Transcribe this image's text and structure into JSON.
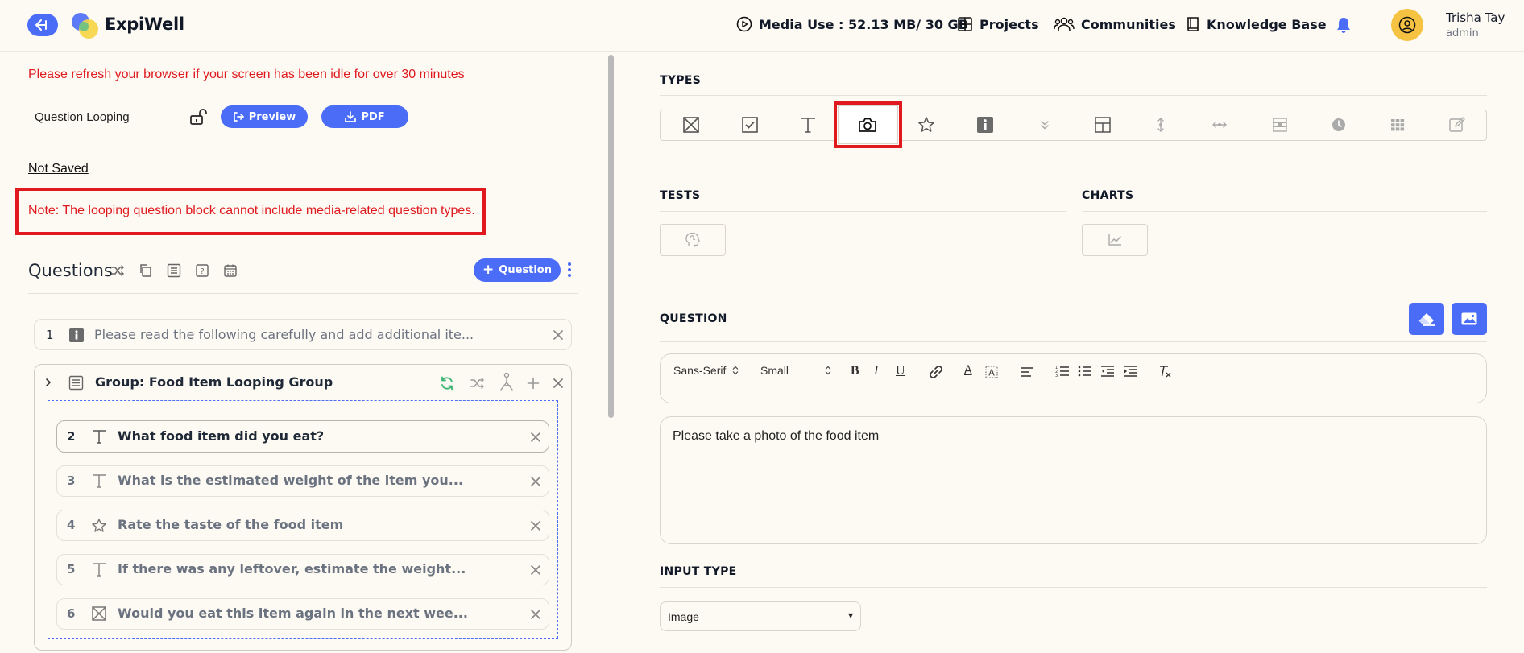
{
  "header": {
    "brand": "ExpiWell",
    "media_use": "Media Use : 52.13 MB/ 30 GB",
    "nav": {
      "projects": "Projects",
      "communities": "Communities",
      "knowledge_base": "Knowledge Base"
    },
    "user": {
      "name": "Trisha Tay",
      "role": "admin"
    }
  },
  "left": {
    "refresh_message": "Please refresh your browser if your screen has been idle for over 30 minutes",
    "looping_label": "Question Looping",
    "preview_label": "Preview",
    "pdf_label": "PDF",
    "not_saved": "Not Saved",
    "note": "Note: The looping question block cannot include media-related question types.",
    "questions_title": "Questions",
    "add_question_label": "Question",
    "first_question": {
      "number": "1",
      "text": "Please read the following carefully and add additional ite..."
    },
    "group": {
      "title": "Group: Food Item Looping Group",
      "items": [
        {
          "number": "2",
          "text": "What food item did you eat?"
        },
        {
          "number": "3",
          "text": "What is the estimated weight of the item you..."
        },
        {
          "number": "4",
          "text": "Rate the taste of the food item"
        },
        {
          "number": "5",
          "text": "If there was any leftover, estimate the weight..."
        },
        {
          "number": "6",
          "text": "Would you eat this item again in the next wee..."
        }
      ]
    }
  },
  "right": {
    "types_label": "TYPES",
    "tests_label": "TESTS",
    "charts_label": "CHARTS",
    "question_label": "QUESTION",
    "toolbar": {
      "font": "Sans-Serif",
      "size": "Small"
    },
    "question_text": "Please take a photo of the food item",
    "input_type_label": "INPUT TYPE",
    "input_type_value": "Image"
  },
  "colors": {
    "accent": "#4a6cf7",
    "alert": "#e0191f",
    "background": "#fdfaf3"
  }
}
